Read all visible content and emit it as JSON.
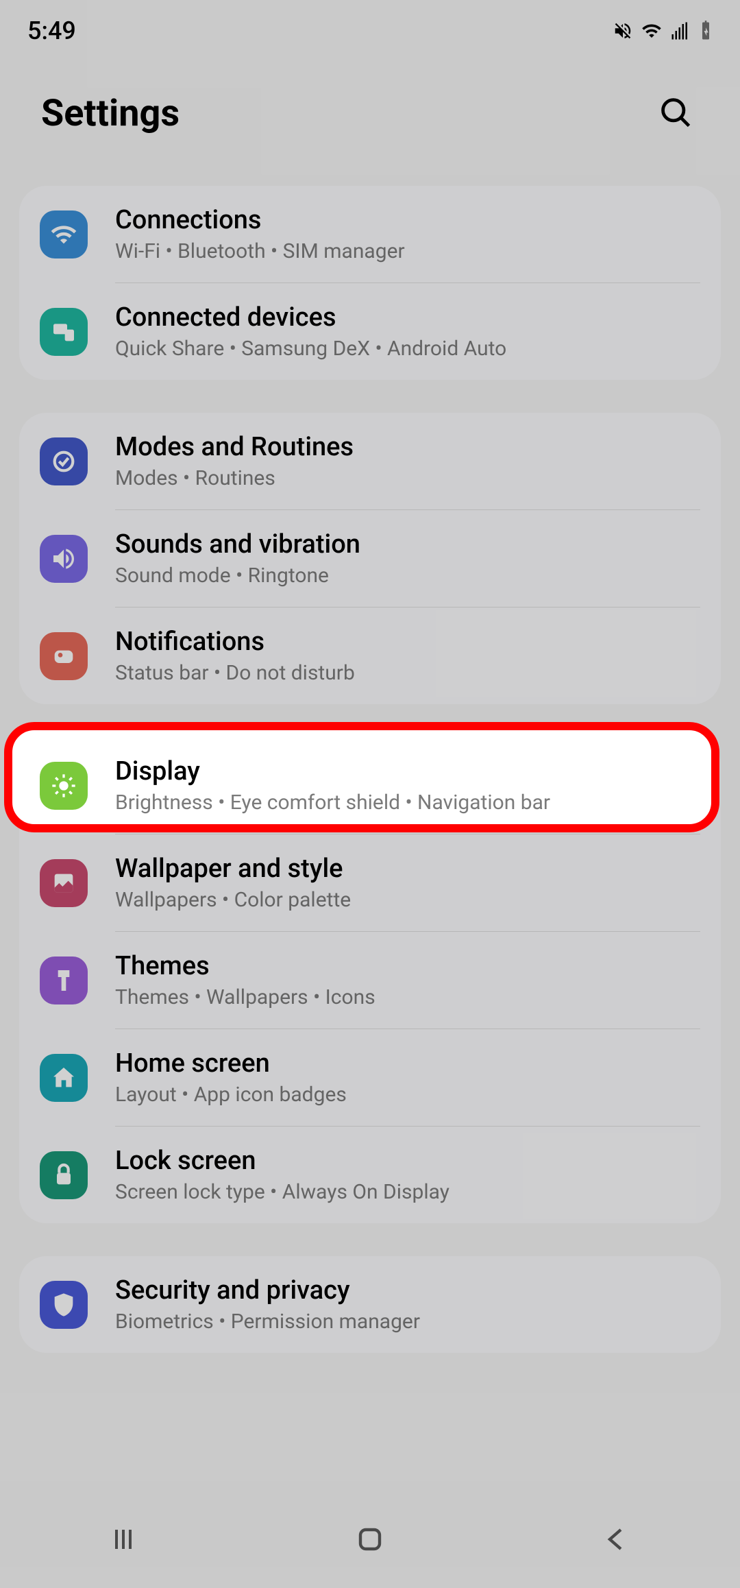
{
  "status": {
    "time": "5:49"
  },
  "header": {
    "title": "Settings"
  },
  "groups": [
    {
      "items": [
        {
          "id": "connections",
          "icon": "wifi-icon",
          "color": "c-blue",
          "title": "Connections",
          "sub": "Wi-Fi  •  Bluetooth  •  SIM manager"
        },
        {
          "id": "connected-devices",
          "icon": "devices-icon",
          "color": "c-teal",
          "title": "Connected devices",
          "sub": "Quick Share  •  Samsung DeX  •  Android Auto"
        }
      ]
    },
    {
      "items": [
        {
          "id": "modes-routines",
          "icon": "routines-icon",
          "color": "c-indigo",
          "title": "Modes and Routines",
          "sub": "Modes  •  Routines"
        },
        {
          "id": "sounds-vibration",
          "icon": "sound-icon",
          "color": "c-violet",
          "title": "Sounds and vibration",
          "sub": "Sound mode  •  Ringtone"
        },
        {
          "id": "notifications",
          "icon": "notifications-icon",
          "color": "c-coral",
          "title": "Notifications",
          "sub": "Status bar  •  Do not disturb"
        }
      ]
    },
    {
      "items": [
        {
          "id": "display",
          "icon": "brightness-icon",
          "color": "c-green",
          "title": "Display",
          "sub": "Brightness  •  Eye comfort shield  •  Navigation bar",
          "highlighted": true
        },
        {
          "id": "wallpaper-style",
          "icon": "image-icon",
          "color": "c-pink",
          "title": "Wallpaper and style",
          "sub": "Wallpapers  •  Color palette"
        },
        {
          "id": "themes",
          "icon": "themes-icon",
          "color": "c-purple",
          "title": "Themes",
          "sub": "Themes  •  Wallpapers  •  Icons"
        },
        {
          "id": "home-screen",
          "icon": "home-icon",
          "color": "c-cyan",
          "title": "Home screen",
          "sub": "Layout  •  App icon badges"
        },
        {
          "id": "lock-screen",
          "icon": "lock-icon",
          "color": "c-dteal",
          "title": "Lock screen",
          "sub": "Screen lock type  •  Always On Display"
        }
      ]
    },
    {
      "items": [
        {
          "id": "security-privacy",
          "icon": "shield-icon",
          "color": "c-dblue",
          "title": "Security and privacy",
          "sub": "Biometrics  •  Permission manager"
        }
      ]
    }
  ]
}
